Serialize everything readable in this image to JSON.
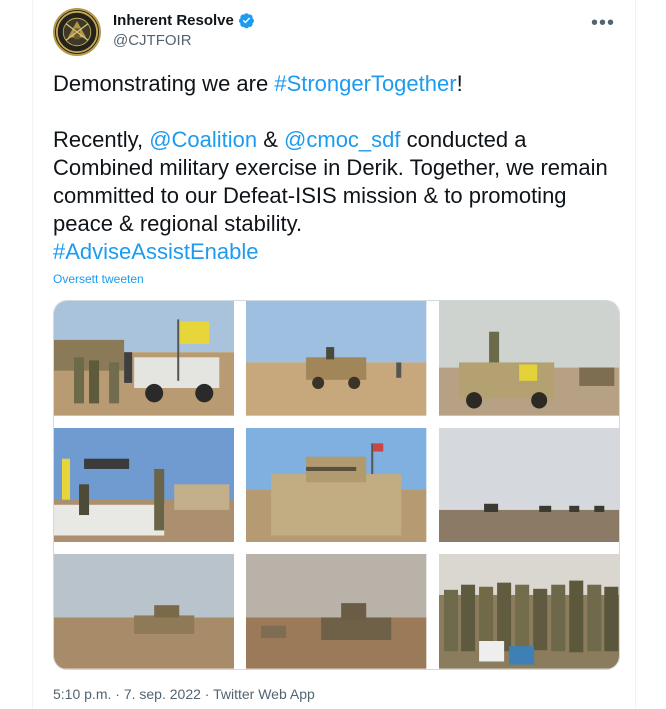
{
  "account": {
    "display_name": "Inherent Resolve",
    "handle": "@CJTFOIR",
    "verified": true,
    "avatar_icon": "cjtf-oir-seal-icon"
  },
  "menu": {
    "more_label": "•••"
  },
  "tweet": {
    "line1_prefix": "Demonstrating we are ",
    "line1_hashtag": "#StrongerTogether",
    "line1_suffix": "!",
    "p2_start": "Recently, ",
    "mention1": "@Coalition",
    "p2_amp": " & ",
    "mention2": "@cmoc_sdf",
    "p2_rest": " conducted a Combined military exercise in Derik. Together, we remain committed to our Defeat-ISIS mission & to promoting peace & regional stability.",
    "hashtag2": "#AdviseAssistEnable"
  },
  "translate_label": "Oversett tweeten",
  "photos": [
    {
      "label": "photo-1"
    },
    {
      "label": "photo-2"
    },
    {
      "label": "photo-3"
    },
    {
      "label": "photo-4"
    },
    {
      "label": "photo-5"
    },
    {
      "label": "photo-6"
    },
    {
      "label": "photo-7"
    },
    {
      "label": "photo-8"
    },
    {
      "label": "photo-9"
    }
  ],
  "footer": {
    "time": "5:10 p.m.",
    "sep1": " · ",
    "date": "7. sep. 2022",
    "sep2": " · ",
    "source": "Twitter Web App"
  },
  "colors": {
    "link": "#1d9bf0",
    "text": "#0f1419",
    "muted": "#536471"
  }
}
